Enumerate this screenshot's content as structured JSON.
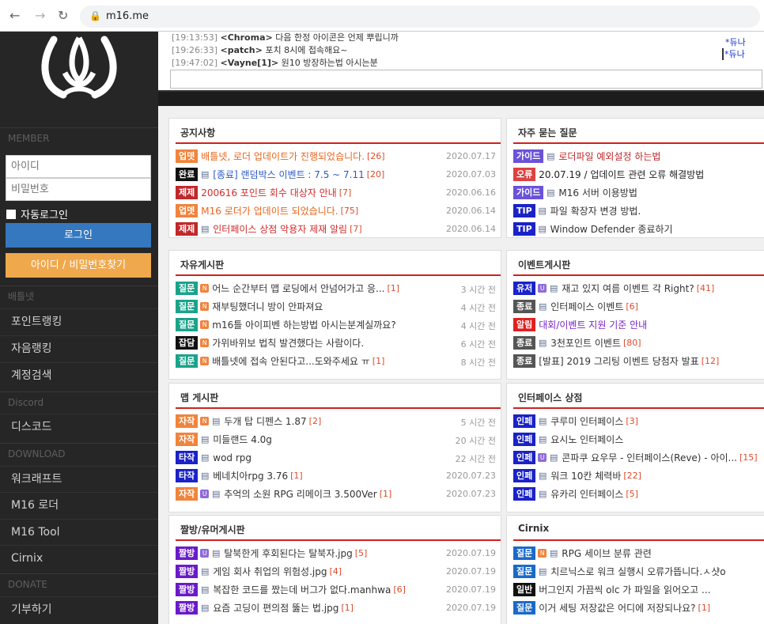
{
  "browser": {
    "url": "m16.me"
  },
  "sidebar": {
    "sections": {
      "member": "MEMBER",
      "battlenet": "배틀넷",
      "discord": "Discord",
      "download": "DOWNLOAD",
      "donate": "DONATE"
    },
    "login": {
      "id_placeholder": "아이디",
      "pw_placeholder": "비밀번호",
      "autologin": "자동로그인",
      "login_button": "로그인",
      "find_button": "아이디 / 비밀번호찾기"
    },
    "battlenet_items": [
      "포인트랭킹",
      "자음랭킹",
      "계정검색"
    ],
    "discord_items": [
      "디스코드"
    ],
    "download_items": [
      "워크래프트",
      "M16 로더",
      "M16 Tool",
      "Cirnix"
    ],
    "donate_items": [
      "기부하기"
    ]
  },
  "chat": {
    "lines": [
      {
        "time": "[19:13:53]",
        "user": "<Chroma>",
        "msg": "다음 한정 아이콘은 언제 뿌립니까"
      },
      {
        "time": "[19:26:33]",
        "user": "<patch>",
        "msg": "포치 8시에 접속해요~"
      },
      {
        "time": "[19:47:02]",
        "user": "<Vayne[1]>",
        "msg": "원10 방장하는법 아시는분"
      }
    ],
    "users": [
      "*듀나",
      "*듀나"
    ]
  },
  "boards": {
    "notice": {
      "title": "공지사항",
      "rows": [
        {
          "badge": "업뎃",
          "badge_color": "#f0843d",
          "icon": "",
          "title": "배틀넷, 로더 업데이트가 진행되었습니다.",
          "title_color": "#e8651c",
          "count": "[26]",
          "date": "2020.07.17"
        },
        {
          "badge": "완료",
          "badge_color": "#111111",
          "icon": "p",
          "title": "[종료] 랜덤박스 이벤트 : 7.5 ~ 7.11",
          "title_color": "#2c58c8",
          "count": "[20]",
          "date": "2020.07.03"
        },
        {
          "badge": "제제",
          "badge_color": "#c0282b",
          "icon": "",
          "title": "200616 포인트 회수 대상자 안내",
          "title_color": "#d22b2b",
          "count": "[7]",
          "date": "2020.06.16"
        },
        {
          "badge": "업뎃",
          "badge_color": "#f0843d",
          "icon": "",
          "title": "M16 로더가 업데이트 되었습니다.",
          "title_color": "#e8651c",
          "count": "[75]",
          "date": "2020.06.14"
        },
        {
          "badge": "제제",
          "badge_color": "#c0282b",
          "icon": "p",
          "title": "인터페이스 상점 악용자 제재 알림",
          "title_color": "#d22b2b",
          "count": "[7]",
          "date": "2020.06.14"
        }
      ]
    },
    "faq": {
      "title": "자주 묻는 질문",
      "rows": [
        {
          "badge": "가이드",
          "badge_color": "#6a52d9",
          "icon": "p",
          "title": "로더파일 예외설정 하는법",
          "title_color": "#c0282b",
          "count": "",
          "date": ""
        },
        {
          "badge": "오류",
          "badge_color": "#e04040",
          "icon": "",
          "title": "20.07.19 / 업데이트 관련 오류 해결방법",
          "title_color": "#222222",
          "count": "",
          "date": ""
        },
        {
          "badge": "가이드",
          "badge_color": "#6a52d9",
          "icon": "p",
          "title": "M16 서버 이용방법",
          "title_color": "#333333",
          "count": "",
          "date": ""
        },
        {
          "badge": "TIP",
          "badge_color": "#1a22c8",
          "icon": "p",
          "title": "파일 확장자 변경 방법.",
          "title_color": "#333333",
          "count": "",
          "date": ""
        },
        {
          "badge": "TIP",
          "badge_color": "#1a22c8",
          "icon": "p",
          "title": "Window Defender 종료하기",
          "title_color": "#333333",
          "count": "",
          "date": ""
        }
      ]
    },
    "free": {
      "title": "자유게시판",
      "rows": [
        {
          "badge": "질문",
          "badge_color": "#1aa38a",
          "icon": "n",
          "title": "어느 순간부터 맵 로딩에서 안넘어가고 응...",
          "title_color": "#333333",
          "count": "[1]",
          "date": "3 시간 전"
        },
        {
          "badge": "질문",
          "badge_color": "#1aa38a",
          "icon": "n",
          "title": "재부팅했더니 방이 안파져요",
          "title_color": "#333333",
          "count": "",
          "date": "4 시간 전"
        },
        {
          "badge": "질문",
          "badge_color": "#1aa38a",
          "icon": "n",
          "title": "m16틀 아이피벤 하는방법 아시는분계실까요?",
          "title_color": "#333333",
          "count": "",
          "date": "4 시간 전"
        },
        {
          "badge": "잡담",
          "badge_color": "#111111",
          "icon": "n",
          "title": "가위바위보 법칙 발견했다는 사람이다.",
          "title_color": "#333333",
          "count": "",
          "date": "6 시간 전"
        },
        {
          "badge": "질문",
          "badge_color": "#1aa38a",
          "icon": "n",
          "title": "배틀넷에 접속 안된다고...도와주세요 ㅠ",
          "title_color": "#333333",
          "count": "[1]",
          "date": "8 시간 전"
        }
      ]
    },
    "event": {
      "title": "이벤트게시판",
      "rows": [
        {
          "badge": "유저",
          "badge_color": "#1a22c8",
          "icon": "up",
          "title": "재고 있지 여름 이벤트 각 Right?",
          "title_color": "#333333",
          "count": "[41]",
          "date": ""
        },
        {
          "badge": "종료",
          "badge_color": "#555555",
          "icon": "p",
          "title": "인터페이스 이벤트",
          "title_color": "#333333",
          "count": "[6]",
          "date": ""
        },
        {
          "badge": "알림",
          "badge_color": "#e02020",
          "icon": "",
          "title": "대회/이벤트 지원 기준 안내",
          "title_color": "#7a22c8",
          "count": "",
          "date": ""
        },
        {
          "badge": "종료",
          "badge_color": "#555555",
          "icon": "p",
          "title": "3천포인트 이벤트",
          "title_color": "#333333",
          "count": "[80]",
          "date": ""
        },
        {
          "badge": "종료",
          "badge_color": "#555555",
          "icon": "",
          "title": "[발표] 2019 그리팅 이벤트 당첨자 발표",
          "title_color": "#333333",
          "count": "[12]",
          "date": ""
        }
      ]
    },
    "map": {
      "title": "맵 게시판",
      "rows": [
        {
          "badge": "자작",
          "badge_color": "#f0843d",
          "icon": "np",
          "title": "두개 탑 디펜스 1.87",
          "title_color": "#333333",
          "count": "[2]",
          "date": "5 시간 전"
        },
        {
          "badge": "자작",
          "badge_color": "#f0843d",
          "icon": "p",
          "title": "미들랜드 4.0g",
          "title_color": "#333333",
          "count": "",
          "date": "20 시간 전"
        },
        {
          "badge": "타작",
          "badge_color": "#1a22c8",
          "icon": "p",
          "title": "wod rpg",
          "title_color": "#333333",
          "count": "",
          "date": "22 시간 전"
        },
        {
          "badge": "타작",
          "badge_color": "#1a22c8",
          "icon": "p",
          "title": "베네치아rpg 3.76",
          "title_color": "#333333",
          "count": "[1]",
          "date": "2020.07.23"
        },
        {
          "badge": "자작",
          "badge_color": "#f0843d",
          "icon": "up",
          "title": "추억의 소원 RPG 리메이크 3.500Ver",
          "title_color": "#333333",
          "count": "[1]",
          "date": "2020.07.23"
        }
      ]
    },
    "interface": {
      "title": "인터페이스 상점",
      "rows": [
        {
          "badge": "인페",
          "badge_color": "#1a22c8",
          "icon": "p",
          "title": "쿠루미 인터페이스",
          "title_color": "#333333",
          "count": "[3]",
          "date": ""
        },
        {
          "badge": "인페",
          "badge_color": "#1a22c8",
          "icon": "p",
          "title": "요시노 인터페이스",
          "title_color": "#333333",
          "count": "",
          "date": ""
        },
        {
          "badge": "인페",
          "badge_color": "#1a22c8",
          "icon": "up",
          "title": "콘파쿠 요우무 - 인터페이스(Reve) - 아이...",
          "title_color": "#333333",
          "count": "[15]",
          "date": ""
        },
        {
          "badge": "인페",
          "badge_color": "#1a22c8",
          "icon": "p",
          "title": "워크 10칸 체력바",
          "title_color": "#333333",
          "count": "[22]",
          "date": ""
        },
        {
          "badge": "인페",
          "badge_color": "#1a22c8",
          "icon": "p",
          "title": "유카리 인터페이스",
          "title_color": "#333333",
          "count": "[5]",
          "date": ""
        }
      ]
    },
    "humor": {
      "title": "짤방/유머게시판",
      "rows": [
        {
          "badge": "짤방",
          "badge_color": "#6a1ac8",
          "icon": "up",
          "title": "탈북한게 후회된다는 탈북자.jpg",
          "title_color": "#333333",
          "count": "[5]",
          "date": "2020.07.19"
        },
        {
          "badge": "짤방",
          "badge_color": "#6a1ac8",
          "icon": "p",
          "title": "게임 회사 취업의 위험성.jpg",
          "title_color": "#333333",
          "count": "[4]",
          "date": "2020.07.19"
        },
        {
          "badge": "짤방",
          "badge_color": "#6a1ac8",
          "icon": "p",
          "title": "복잡한 코드를 짰는데 버그가 없다.manhwa",
          "title_color": "#333333",
          "count": "[6]",
          "date": "2020.07.19"
        },
        {
          "badge": "짤방",
          "badge_color": "#6a1ac8",
          "icon": "p",
          "title": "요즘 고딩이 편의점 뚫는 법.jpg",
          "title_color": "#333333",
          "count": "[1]",
          "date": "2020.07.19"
        }
      ]
    },
    "cirnix": {
      "title": "Cirnix",
      "rows": [
        {
          "badge": "질문",
          "badge_color": "#1a6ac8",
          "icon": "np",
          "title": "RPG 세이브 분류 관련",
          "title_color": "#333333",
          "count": "",
          "date": ""
        },
        {
          "badge": "질문",
          "badge_color": "#1a6ac8",
          "icon": "p",
          "title": "치르닉스로 워크 실행시 오류가뜹니다.ㅅ샷o",
          "title_color": "#333333",
          "count": "",
          "date": ""
        },
        {
          "badge": "일반",
          "badge_color": "#111111",
          "icon": "",
          "title": "버그인지 가끔씩 olc 가 파일을 읽어오고 ...",
          "title_color": "#333333",
          "count": "",
          "date": ""
        },
        {
          "badge": "질문",
          "badge_color": "#1a6ac8",
          "icon": "",
          "title": "이거 세팅 저장값은 어디에 저장되나요?",
          "title_color": "#333333",
          "count": "[1]",
          "date": ""
        }
      ]
    }
  }
}
